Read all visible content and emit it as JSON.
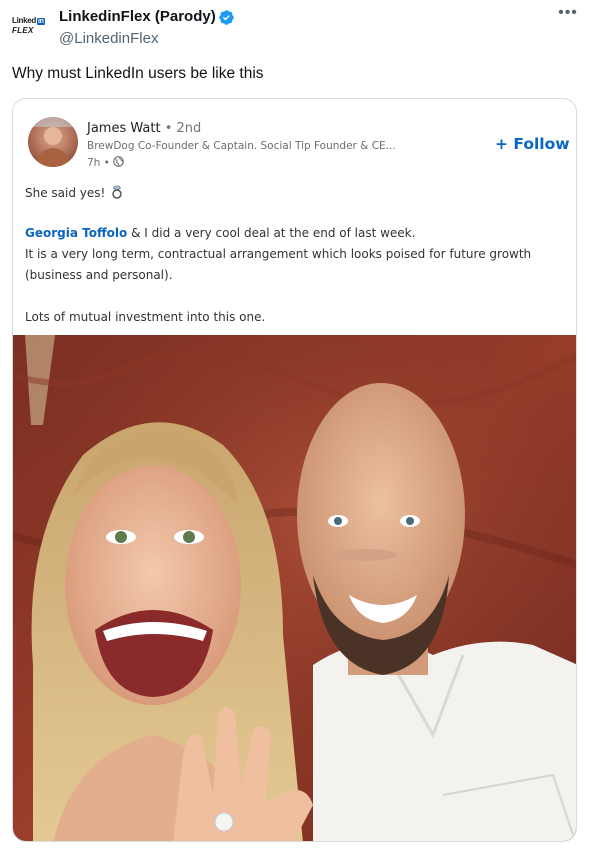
{
  "tweet": {
    "account_name": "LinkedinFlex (Parody)",
    "handle": "@LinkedinFlex",
    "logo": {
      "line1": "Linked",
      "in_badge": "in",
      "line2": "FLEX"
    },
    "more_icon": "more-dots-icon",
    "text": "Why must LinkedIn users be like this"
  },
  "linkedin_post": {
    "author": "James Watt",
    "degree": "• 2nd",
    "headline": "BrewDog Co-Founder & Captain. Social Tip Founder & CE...",
    "time": "7h •",
    "follow_label": "+ Follow",
    "line1": "She said yes!",
    "mention": "Georgia Toffolo",
    "line2_rest": " & I did a very cool deal at the end of last week.",
    "line3": "It is a very long term, contractual arrangement which looks poised for future growth",
    "line4": "(business and personal).",
    "line5": "Lots of mutual investment into this one."
  },
  "colors": {
    "verified": "#1d9bf0",
    "linkedin_blue": "#0a66c2",
    "text_secondary": "#536471"
  }
}
